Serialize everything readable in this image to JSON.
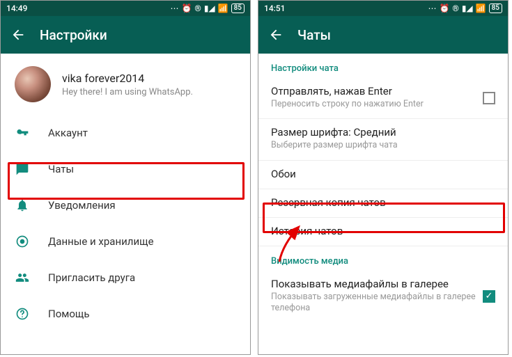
{
  "left": {
    "status_time": "14:49",
    "status_right": "...",
    "battery": "85",
    "appbar_title": "Настройки",
    "profile": {
      "name": "vika forever2014",
      "status": "Hey there! I am using WhatsApp."
    },
    "menu": {
      "account": "Аккаунт",
      "chats": "Чаты",
      "notifications": "Уведомления",
      "data": "Данные и хранилище",
      "invite": "Пригласить друга",
      "help": "Помощь"
    }
  },
  "right": {
    "status_time": "14:51",
    "battery": "85",
    "appbar_title": "Чаты",
    "section1": "Настройки чата",
    "enter_send": {
      "title": "Отправлять, нажав Enter",
      "sub": "Переносить строку по нажатию Enter"
    },
    "font_size": {
      "title": "Размер шрифта: Средний",
      "sub": "Выберите размер шрифта чата"
    },
    "wallpaper": "Обои",
    "backup": "Резервная копия чатов",
    "history": "История чатов",
    "section2": "Видимость медиа",
    "media_vis": {
      "title": "Показывать медиафайлы в галерее",
      "sub": "Показывать загруженные медиафайлы в галерее телефона"
    }
  }
}
